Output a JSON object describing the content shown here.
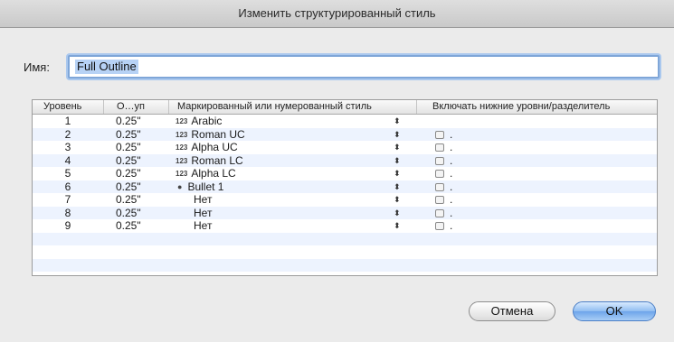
{
  "window": {
    "title": "Изменить структурированный стиль"
  },
  "name_field": {
    "label": "Имя:",
    "value": "Full Outline"
  },
  "table": {
    "columns": [
      "Уровень",
      "О…уп",
      "Маркированный или нумерованный стиль",
      "Включать нижние уровни/разделитель"
    ],
    "rows": [
      {
        "level": "1",
        "indent": "0.25\"",
        "style": "Arabic",
        "style_icon": "numbering-icon",
        "checkbox": false,
        "separator": ""
      },
      {
        "level": "2",
        "indent": "0.25\"",
        "style": "Roman UC",
        "style_icon": "numbering-icon",
        "checkbox": true,
        "separator": "."
      },
      {
        "level": "3",
        "indent": "0.25\"",
        "style": "Alpha UC",
        "style_icon": "numbering-icon",
        "checkbox": true,
        "separator": "."
      },
      {
        "level": "4",
        "indent": "0.25\"",
        "style": "Roman LC",
        "style_icon": "numbering-icon",
        "checkbox": true,
        "separator": "."
      },
      {
        "level": "5",
        "indent": "0.25\"",
        "style": "Alpha LC",
        "style_icon": "numbering-icon",
        "checkbox": true,
        "separator": "."
      },
      {
        "level": "6",
        "indent": "0.25\"",
        "style": "Bullet 1",
        "style_icon": "bullet-icon",
        "checkbox": true,
        "separator": "."
      },
      {
        "level": "7",
        "indent": "0.25\"",
        "style": "Нет",
        "style_icon": "none",
        "checkbox": true,
        "separator": "."
      },
      {
        "level": "8",
        "indent": "0.25\"",
        "style": "Нет",
        "style_icon": "none",
        "checkbox": true,
        "separator": "."
      },
      {
        "level": "9",
        "indent": "0.25\"",
        "style": "Нет",
        "style_icon": "none",
        "checkbox": true,
        "separator": "."
      }
    ],
    "icon_text": {
      "numbering": "123",
      "bullet": "●",
      "arrows": "⬍"
    }
  },
  "buttons": {
    "cancel": "Отмена",
    "ok": "OK"
  },
  "colors": {
    "accent": "#6da5ea",
    "selection": "#b7d2f5",
    "alt_row": "#edf3fe"
  }
}
